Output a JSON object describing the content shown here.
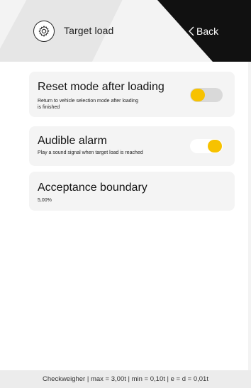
{
  "header": {
    "title": "Target load",
    "back_label": "Back",
    "settings_icon": "gear-icon"
  },
  "settings": [
    {
      "title": "Reset mode after loading",
      "description_line1": "Return to vehicle selection mode after loading",
      "description_line2": "is finished",
      "toggle_state": "on"
    },
    {
      "title": "Audible alarm",
      "description": "Play a sound signal when target load is reached",
      "toggle_state": "on"
    },
    {
      "title": "Acceptance boundary",
      "value": "5,00%"
    }
  ],
  "footer": {
    "status": "Checkweigher | max = 3,00t | min = 0,10t | e = d = 0,01t"
  },
  "colors": {
    "accent": "#f7c200",
    "header_dark": "#111111",
    "card_bg": "#f4f4f4"
  }
}
